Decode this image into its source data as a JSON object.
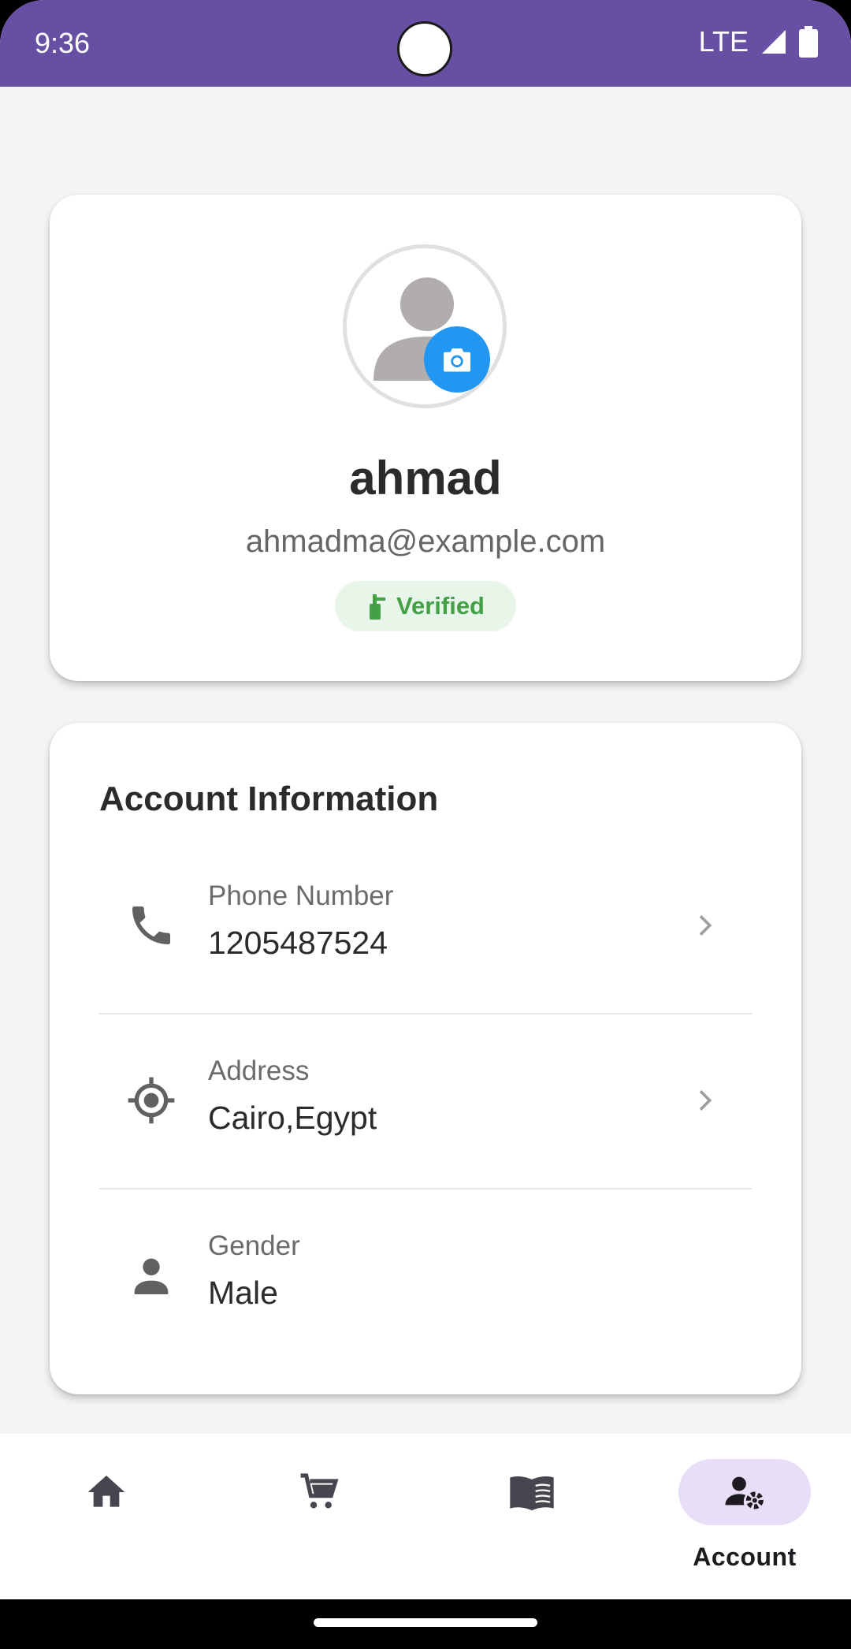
{
  "status_bar": {
    "time": "9:36",
    "network": "LTE",
    "icons": [
      "signal-icon",
      "battery-icon"
    ],
    "background": "#6750a4"
  },
  "profile": {
    "name": "ahmad",
    "email": "ahmadma@example.com",
    "verified_label": "Verified",
    "avatar_icon": "person-placeholder-icon",
    "camera_icon": "camera-icon",
    "accent": "#2196f3",
    "verified_color": "#43a047"
  },
  "account_info": {
    "title": "Account Information",
    "rows": [
      {
        "icon": "phone-icon",
        "label": "Phone Number",
        "value": "1205487524",
        "has_chevron": true
      },
      {
        "icon": "location-icon",
        "label": "Address",
        "value": "Cairo,Egypt",
        "has_chevron": true
      },
      {
        "icon": "person-icon",
        "label": "Gender",
        "value": "Male",
        "has_chevron": false
      }
    ]
  },
  "bottom_nav": {
    "items": [
      {
        "icon": "home-icon",
        "label": ""
      },
      {
        "icon": "cart-icon",
        "label": ""
      },
      {
        "icon": "book-icon",
        "label": ""
      },
      {
        "icon": "account-settings-icon",
        "label": "Account",
        "active": true
      }
    ],
    "active_pill_color": "#e8def8"
  }
}
